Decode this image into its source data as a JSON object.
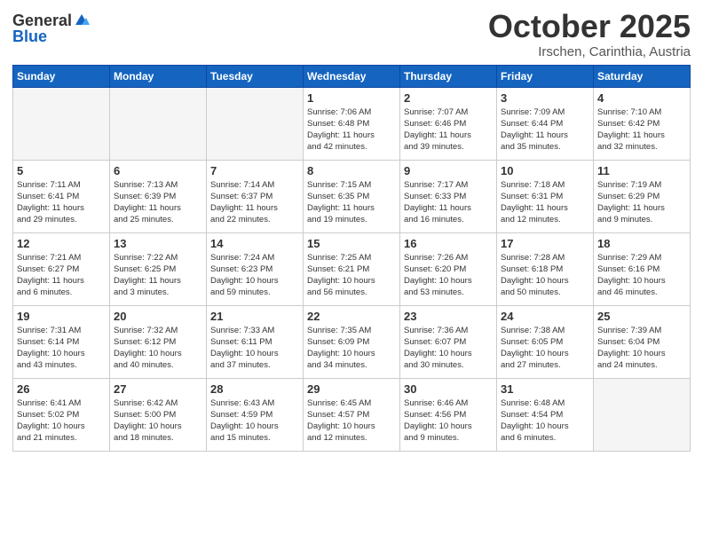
{
  "header": {
    "logo_general": "General",
    "logo_blue": "Blue",
    "month_title": "October 2025",
    "location": "Irschen, Carinthia, Austria"
  },
  "days_of_week": [
    "Sunday",
    "Monday",
    "Tuesday",
    "Wednesday",
    "Thursday",
    "Friday",
    "Saturday"
  ],
  "weeks": [
    [
      {
        "day": "",
        "info": ""
      },
      {
        "day": "",
        "info": ""
      },
      {
        "day": "",
        "info": ""
      },
      {
        "day": "1",
        "info": "Sunrise: 7:06 AM\nSunset: 6:48 PM\nDaylight: 11 hours\nand 42 minutes."
      },
      {
        "day": "2",
        "info": "Sunrise: 7:07 AM\nSunset: 6:46 PM\nDaylight: 11 hours\nand 39 minutes."
      },
      {
        "day": "3",
        "info": "Sunrise: 7:09 AM\nSunset: 6:44 PM\nDaylight: 11 hours\nand 35 minutes."
      },
      {
        "day": "4",
        "info": "Sunrise: 7:10 AM\nSunset: 6:42 PM\nDaylight: 11 hours\nand 32 minutes."
      }
    ],
    [
      {
        "day": "5",
        "info": "Sunrise: 7:11 AM\nSunset: 6:41 PM\nDaylight: 11 hours\nand 29 minutes."
      },
      {
        "day": "6",
        "info": "Sunrise: 7:13 AM\nSunset: 6:39 PM\nDaylight: 11 hours\nand 25 minutes."
      },
      {
        "day": "7",
        "info": "Sunrise: 7:14 AM\nSunset: 6:37 PM\nDaylight: 11 hours\nand 22 minutes."
      },
      {
        "day": "8",
        "info": "Sunrise: 7:15 AM\nSunset: 6:35 PM\nDaylight: 11 hours\nand 19 minutes."
      },
      {
        "day": "9",
        "info": "Sunrise: 7:17 AM\nSunset: 6:33 PM\nDaylight: 11 hours\nand 16 minutes."
      },
      {
        "day": "10",
        "info": "Sunrise: 7:18 AM\nSunset: 6:31 PM\nDaylight: 11 hours\nand 12 minutes."
      },
      {
        "day": "11",
        "info": "Sunrise: 7:19 AM\nSunset: 6:29 PM\nDaylight: 11 hours\nand 9 minutes."
      }
    ],
    [
      {
        "day": "12",
        "info": "Sunrise: 7:21 AM\nSunset: 6:27 PM\nDaylight: 11 hours\nand 6 minutes."
      },
      {
        "day": "13",
        "info": "Sunrise: 7:22 AM\nSunset: 6:25 PM\nDaylight: 11 hours\nand 3 minutes."
      },
      {
        "day": "14",
        "info": "Sunrise: 7:24 AM\nSunset: 6:23 PM\nDaylight: 10 hours\nand 59 minutes."
      },
      {
        "day": "15",
        "info": "Sunrise: 7:25 AM\nSunset: 6:21 PM\nDaylight: 10 hours\nand 56 minutes."
      },
      {
        "day": "16",
        "info": "Sunrise: 7:26 AM\nSunset: 6:20 PM\nDaylight: 10 hours\nand 53 minutes."
      },
      {
        "day": "17",
        "info": "Sunrise: 7:28 AM\nSunset: 6:18 PM\nDaylight: 10 hours\nand 50 minutes."
      },
      {
        "day": "18",
        "info": "Sunrise: 7:29 AM\nSunset: 6:16 PM\nDaylight: 10 hours\nand 46 minutes."
      }
    ],
    [
      {
        "day": "19",
        "info": "Sunrise: 7:31 AM\nSunset: 6:14 PM\nDaylight: 10 hours\nand 43 minutes."
      },
      {
        "day": "20",
        "info": "Sunrise: 7:32 AM\nSunset: 6:12 PM\nDaylight: 10 hours\nand 40 minutes."
      },
      {
        "day": "21",
        "info": "Sunrise: 7:33 AM\nSunset: 6:11 PM\nDaylight: 10 hours\nand 37 minutes."
      },
      {
        "day": "22",
        "info": "Sunrise: 7:35 AM\nSunset: 6:09 PM\nDaylight: 10 hours\nand 34 minutes."
      },
      {
        "day": "23",
        "info": "Sunrise: 7:36 AM\nSunset: 6:07 PM\nDaylight: 10 hours\nand 30 minutes."
      },
      {
        "day": "24",
        "info": "Sunrise: 7:38 AM\nSunset: 6:05 PM\nDaylight: 10 hours\nand 27 minutes."
      },
      {
        "day": "25",
        "info": "Sunrise: 7:39 AM\nSunset: 6:04 PM\nDaylight: 10 hours\nand 24 minutes."
      }
    ],
    [
      {
        "day": "26",
        "info": "Sunrise: 6:41 AM\nSunset: 5:02 PM\nDaylight: 10 hours\nand 21 minutes."
      },
      {
        "day": "27",
        "info": "Sunrise: 6:42 AM\nSunset: 5:00 PM\nDaylight: 10 hours\nand 18 minutes."
      },
      {
        "day": "28",
        "info": "Sunrise: 6:43 AM\nSunset: 4:59 PM\nDaylight: 10 hours\nand 15 minutes."
      },
      {
        "day": "29",
        "info": "Sunrise: 6:45 AM\nSunset: 4:57 PM\nDaylight: 10 hours\nand 12 minutes."
      },
      {
        "day": "30",
        "info": "Sunrise: 6:46 AM\nSunset: 4:56 PM\nDaylight: 10 hours\nand 9 minutes."
      },
      {
        "day": "31",
        "info": "Sunrise: 6:48 AM\nSunset: 4:54 PM\nDaylight: 10 hours\nand 6 minutes."
      },
      {
        "day": "",
        "info": ""
      }
    ]
  ]
}
